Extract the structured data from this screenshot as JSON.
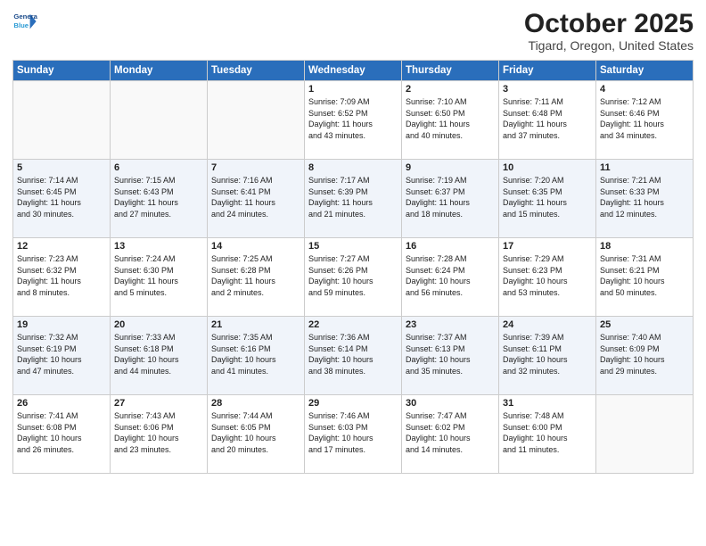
{
  "logo": {
    "line1": "General",
    "line2": "Blue"
  },
  "title": "October 2025",
  "location": "Tigard, Oregon, United States",
  "days_of_week": [
    "Sunday",
    "Monday",
    "Tuesday",
    "Wednesday",
    "Thursday",
    "Friday",
    "Saturday"
  ],
  "weeks": [
    [
      {
        "day": "",
        "content": ""
      },
      {
        "day": "",
        "content": ""
      },
      {
        "day": "",
        "content": ""
      },
      {
        "day": "1",
        "content": "Sunrise: 7:09 AM\nSunset: 6:52 PM\nDaylight: 11 hours\nand 43 minutes."
      },
      {
        "day": "2",
        "content": "Sunrise: 7:10 AM\nSunset: 6:50 PM\nDaylight: 11 hours\nand 40 minutes."
      },
      {
        "day": "3",
        "content": "Sunrise: 7:11 AM\nSunset: 6:48 PM\nDaylight: 11 hours\nand 37 minutes."
      },
      {
        "day": "4",
        "content": "Sunrise: 7:12 AM\nSunset: 6:46 PM\nDaylight: 11 hours\nand 34 minutes."
      }
    ],
    [
      {
        "day": "5",
        "content": "Sunrise: 7:14 AM\nSunset: 6:45 PM\nDaylight: 11 hours\nand 30 minutes."
      },
      {
        "day": "6",
        "content": "Sunrise: 7:15 AM\nSunset: 6:43 PM\nDaylight: 11 hours\nand 27 minutes."
      },
      {
        "day": "7",
        "content": "Sunrise: 7:16 AM\nSunset: 6:41 PM\nDaylight: 11 hours\nand 24 minutes."
      },
      {
        "day": "8",
        "content": "Sunrise: 7:17 AM\nSunset: 6:39 PM\nDaylight: 11 hours\nand 21 minutes."
      },
      {
        "day": "9",
        "content": "Sunrise: 7:19 AM\nSunset: 6:37 PM\nDaylight: 11 hours\nand 18 minutes."
      },
      {
        "day": "10",
        "content": "Sunrise: 7:20 AM\nSunset: 6:35 PM\nDaylight: 11 hours\nand 15 minutes."
      },
      {
        "day": "11",
        "content": "Sunrise: 7:21 AM\nSunset: 6:33 PM\nDaylight: 11 hours\nand 12 minutes."
      }
    ],
    [
      {
        "day": "12",
        "content": "Sunrise: 7:23 AM\nSunset: 6:32 PM\nDaylight: 11 hours\nand 8 minutes."
      },
      {
        "day": "13",
        "content": "Sunrise: 7:24 AM\nSunset: 6:30 PM\nDaylight: 11 hours\nand 5 minutes."
      },
      {
        "day": "14",
        "content": "Sunrise: 7:25 AM\nSunset: 6:28 PM\nDaylight: 11 hours\nand 2 minutes."
      },
      {
        "day": "15",
        "content": "Sunrise: 7:27 AM\nSunset: 6:26 PM\nDaylight: 10 hours\nand 59 minutes."
      },
      {
        "day": "16",
        "content": "Sunrise: 7:28 AM\nSunset: 6:24 PM\nDaylight: 10 hours\nand 56 minutes."
      },
      {
        "day": "17",
        "content": "Sunrise: 7:29 AM\nSunset: 6:23 PM\nDaylight: 10 hours\nand 53 minutes."
      },
      {
        "day": "18",
        "content": "Sunrise: 7:31 AM\nSunset: 6:21 PM\nDaylight: 10 hours\nand 50 minutes."
      }
    ],
    [
      {
        "day": "19",
        "content": "Sunrise: 7:32 AM\nSunset: 6:19 PM\nDaylight: 10 hours\nand 47 minutes."
      },
      {
        "day": "20",
        "content": "Sunrise: 7:33 AM\nSunset: 6:18 PM\nDaylight: 10 hours\nand 44 minutes."
      },
      {
        "day": "21",
        "content": "Sunrise: 7:35 AM\nSunset: 6:16 PM\nDaylight: 10 hours\nand 41 minutes."
      },
      {
        "day": "22",
        "content": "Sunrise: 7:36 AM\nSunset: 6:14 PM\nDaylight: 10 hours\nand 38 minutes."
      },
      {
        "day": "23",
        "content": "Sunrise: 7:37 AM\nSunset: 6:13 PM\nDaylight: 10 hours\nand 35 minutes."
      },
      {
        "day": "24",
        "content": "Sunrise: 7:39 AM\nSunset: 6:11 PM\nDaylight: 10 hours\nand 32 minutes."
      },
      {
        "day": "25",
        "content": "Sunrise: 7:40 AM\nSunset: 6:09 PM\nDaylight: 10 hours\nand 29 minutes."
      }
    ],
    [
      {
        "day": "26",
        "content": "Sunrise: 7:41 AM\nSunset: 6:08 PM\nDaylight: 10 hours\nand 26 minutes."
      },
      {
        "day": "27",
        "content": "Sunrise: 7:43 AM\nSunset: 6:06 PM\nDaylight: 10 hours\nand 23 minutes."
      },
      {
        "day": "28",
        "content": "Sunrise: 7:44 AM\nSunset: 6:05 PM\nDaylight: 10 hours\nand 20 minutes."
      },
      {
        "day": "29",
        "content": "Sunrise: 7:46 AM\nSunset: 6:03 PM\nDaylight: 10 hours\nand 17 minutes."
      },
      {
        "day": "30",
        "content": "Sunrise: 7:47 AM\nSunset: 6:02 PM\nDaylight: 10 hours\nand 14 minutes."
      },
      {
        "day": "31",
        "content": "Sunrise: 7:48 AM\nSunset: 6:00 PM\nDaylight: 10 hours\nand 11 minutes."
      },
      {
        "day": "",
        "content": ""
      }
    ]
  ]
}
